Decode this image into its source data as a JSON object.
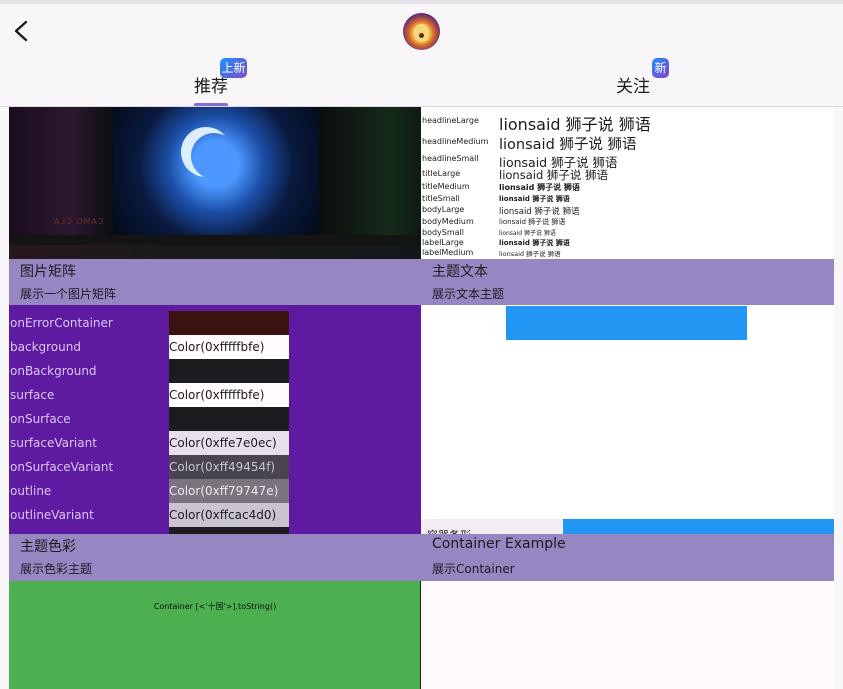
{
  "header": {
    "back_icon": "chevron-left-icon",
    "avatar_icon": "lion-avatar"
  },
  "tabs": [
    {
      "label": "推荐",
      "badge": "上新"
    },
    {
      "label": "关注",
      "badge": "新"
    }
  ],
  "cards": {
    "image_matrix": {
      "title": "图片矩阵",
      "subtitle": "展示一个图片矩阵",
      "image_text": "CAMO CLA"
    },
    "theme_text": {
      "title": "主题文本",
      "subtitle": "展示文本主题",
      "rows": [
        {
          "key": "headlineLarge",
          "value": "lionsaid 狮子说 狮语"
        },
        {
          "key": "headlineMedium",
          "value": "lionsaid 狮子说 狮语"
        },
        {
          "key": "headlineSmall",
          "value": "lionsaid 狮子说 狮语"
        },
        {
          "key": "titleLarge",
          "value": "lionsaid 狮子说 狮语"
        },
        {
          "key": "titleMedium",
          "value": "lionsaid 狮子说 狮语"
        },
        {
          "key": "titleSmall",
          "value": "lionsaid 狮子说 狮语"
        },
        {
          "key": "bodyLarge",
          "value": "lionsaid 狮子说 狮语"
        },
        {
          "key": "bodyMedium",
          "value": "lionsaid 狮子说 狮语"
        },
        {
          "key": "bodySmall",
          "value": "lionsaid 狮子说 狮语"
        },
        {
          "key": "labelLarge",
          "value": "lionsaid 狮子说 狮语"
        },
        {
          "key": "labelMedium",
          "value": "lionsaid 狮子说 狮语"
        }
      ]
    },
    "theme_color": {
      "title": "主题色彩",
      "subtitle": "展示色彩主题",
      "rows": [
        {
          "name": "onErrorContainer",
          "value": "",
          "bg": "#3a1310",
          "fg": "#ffffff"
        },
        {
          "name": "background",
          "value": "Color(0xfffffbfe)",
          "bg": "#fffbfe",
          "fg": "#1d1b20"
        },
        {
          "name": "onBackground",
          "value": "",
          "bg": "#1c1b1f",
          "fg": "#ffffff"
        },
        {
          "name": "surface",
          "value": "Color(0xfffffbfe)",
          "bg": "#fffbfe",
          "fg": "#1d1b20"
        },
        {
          "name": "onSurface",
          "value": "",
          "bg": "#1c1b1f",
          "fg": "#ffffff"
        },
        {
          "name": "surfaceVariant",
          "value": "Color(0xffe7e0ec)",
          "bg": "#e7e0ec",
          "fg": "#1d1b20"
        },
        {
          "name": "onSurfaceVariant",
          "value": "Color(0xff49454f)",
          "bg": "#49454f",
          "fg": "#c9c4d0"
        },
        {
          "name": "outline",
          "value": "Color(0xff79747e)",
          "bg": "#79747e",
          "fg": "#ece8f0"
        },
        {
          "name": "outlineVariant",
          "value": "Color(0xffcac4d0)",
          "bg": "#cac4d0",
          "fg": "#1d1b20"
        }
      ]
    },
    "container": {
      "title": "Container Example",
      "subtitle": "展示Container",
      "peek_label": "容器备形"
    },
    "green_container": {
      "text": "Container [<'十国'>].toString()"
    }
  },
  "colors": {
    "label_bg": "#9686c2",
    "color_card_bg": "#5e1aa1",
    "blue": "#2196f3",
    "green": "#4caf50"
  }
}
